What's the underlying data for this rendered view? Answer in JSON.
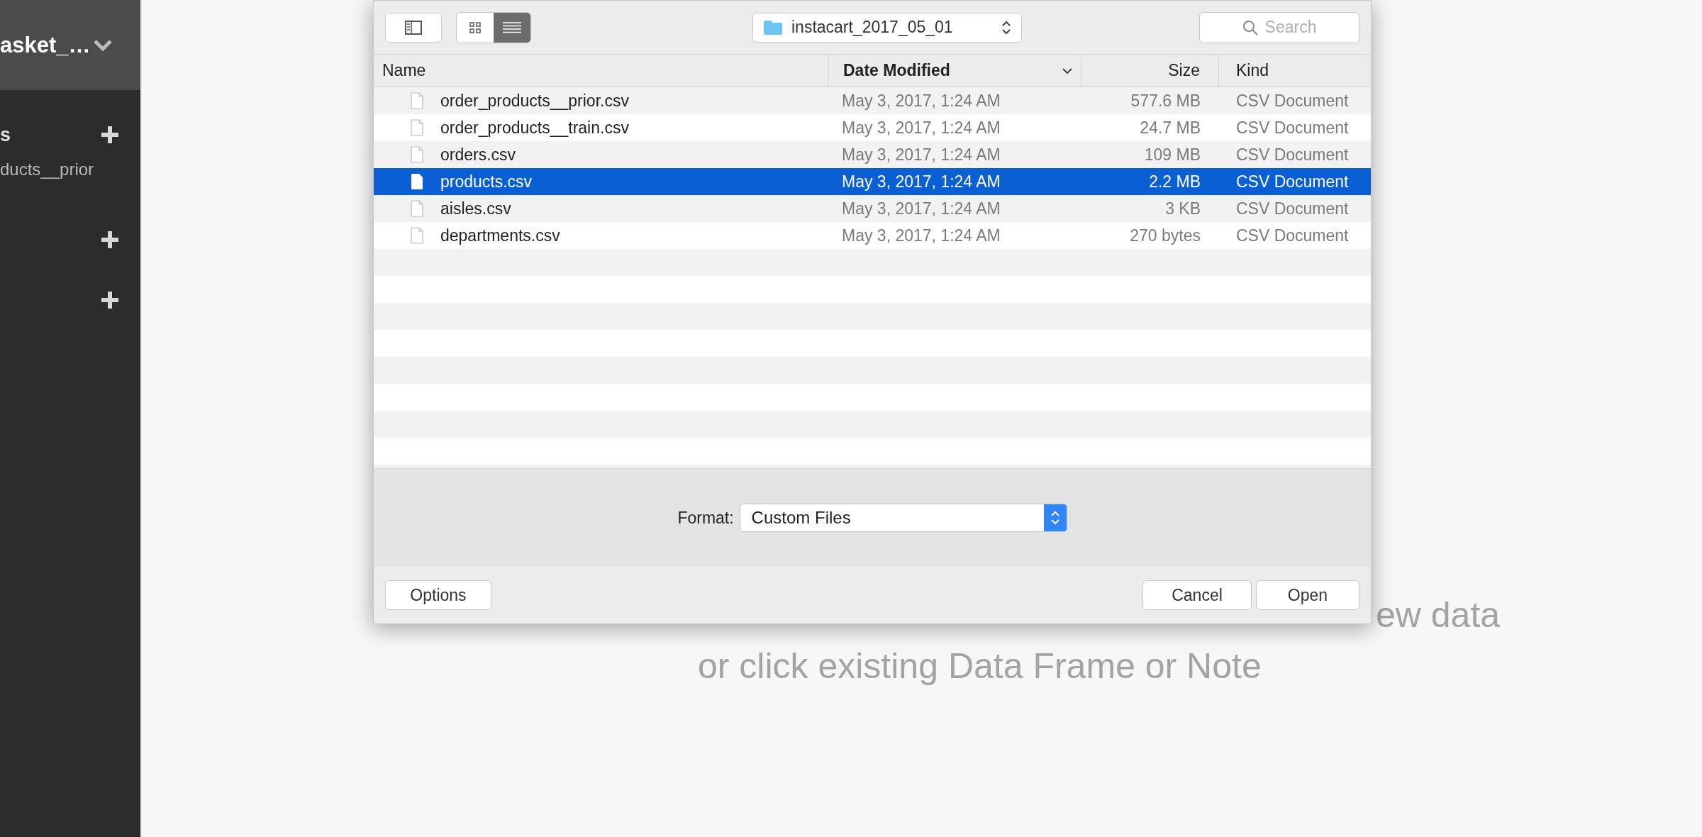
{
  "sidebar": {
    "title": "asket_…",
    "sections": [
      {
        "kind": "labeled",
        "heading": "s",
        "items": [
          {
            "label": "ducts__prior"
          }
        ]
      },
      {
        "kind": "unlabeled"
      },
      {
        "kind": "unlabeled"
      }
    ]
  },
  "dialog": {
    "toolbar": {
      "view_modes": [
        {
          "kind": "icons",
          "selected": false
        },
        {
          "kind": "list",
          "selected": true
        }
      ],
      "location": "instacart_2017_05_01",
      "search": {
        "placeholder": "Search"
      }
    },
    "columns": [
      {
        "label": "Name",
        "sorted": false
      },
      {
        "label": "Date Modified",
        "sorted": true
      },
      {
        "label": "Size",
        "sorted": false
      },
      {
        "label": "Kind",
        "sorted": false
      }
    ],
    "files": [
      {
        "name": "order_products__prior.csv",
        "date": "May 3, 2017, 1:24 AM",
        "size": "577.6 MB",
        "kind": "CSV Document",
        "selected": false
      },
      {
        "name": "order_products__train.csv",
        "date": "May 3, 2017, 1:24 AM",
        "size": "24.7 MB",
        "kind": "CSV Document",
        "selected": false
      },
      {
        "name": "orders.csv",
        "date": "May 3, 2017, 1:24 AM",
        "size": "109 MB",
        "kind": "CSV Document",
        "selected": false
      },
      {
        "name": "products.csv",
        "date": "May 3, 2017, 1:24 AM",
        "size": "2.2 MB",
        "kind": "CSV Document",
        "selected": true
      },
      {
        "name": "aisles.csv",
        "date": "May 3, 2017, 1:24 AM",
        "size": "3 KB",
        "kind": "CSV Document",
        "selected": false
      },
      {
        "name": "departments.csv",
        "date": "May 3, 2017, 1:24 AM",
        "size": "270 bytes",
        "kind": "CSV Document",
        "selected": false
      }
    ],
    "format": {
      "label": "Format:",
      "value": "Custom Files"
    },
    "buttons": [
      "Options",
      "Cancel",
      "Open"
    ]
  },
  "hint": {
    "line_1_visible": "ew data",
    "line_2": "or click existing Data Frame or Note"
  }
}
